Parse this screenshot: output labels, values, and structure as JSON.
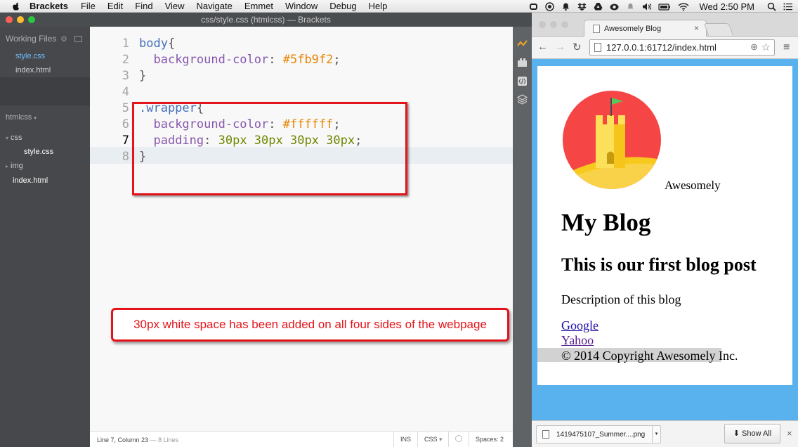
{
  "menubar": {
    "app_name": "Brackets",
    "menus": [
      "File",
      "Edit",
      "Find",
      "View",
      "Navigate",
      "Emmet",
      "Window",
      "Debug",
      "Help"
    ],
    "clock": "Wed 2:50 PM"
  },
  "brackets": {
    "window_title": "css/style.css (htmlcss) — Brackets",
    "working_files_header": "Working Files",
    "working_files": [
      "style.css",
      "index.html"
    ],
    "project_name": "htmlcss",
    "tree": {
      "folder_css": "css",
      "file_style": "style.css",
      "folder_img": "img",
      "file_index": "index.html"
    },
    "line_numbers": [
      "1",
      "2",
      "3",
      "4",
      "5",
      "6",
      "7",
      "8"
    ],
    "code": {
      "l1_sel": "body",
      "l1_brace": "{",
      "l2_prop": "background-color",
      "l2_colon": ": ",
      "l2_val": "#5fb9f2",
      "l2_semi": ";",
      "l3": "}",
      "l5_sel": ".wrapper",
      "l5_brace": "{",
      "l6_prop": "background-color",
      "l6_colon": ": ",
      "l6_val": "#ffffff",
      "l6_semi": ";",
      "l7_prop": "padding",
      "l7_colon": ": ",
      "l7_val": "30px 30px 30px 30px",
      "l7_semi": ";",
      "l8": "}"
    },
    "callout_text": "30px white space has been added on all four sides of the webpage",
    "status": {
      "cursor": "Line 7, Column 23",
      "lines": "— 8 Lines",
      "ins": "INS",
      "mode": "CSS",
      "spaces": "Spaces: 2"
    },
    "active_line": 7
  },
  "chrome": {
    "tab_title": "Awesomely Blog",
    "tab_close": "×",
    "url": "127.0.0.1:61712/index.html",
    "page": {
      "logo_caption": "Awesomely",
      "h1": "My Blog",
      "h2": "This is our first blog post",
      "description": "Description of this blog",
      "links": [
        "Google",
        "Yahoo"
      ],
      "footer": "© 2014 Copyright Awesomely Inc."
    },
    "download": {
      "filename": "1419475107_Summer....png",
      "show_all": "Show All"
    }
  },
  "colors": {
    "body_bg": "#5fb9f2",
    "callout_red": "#e5141a"
  }
}
